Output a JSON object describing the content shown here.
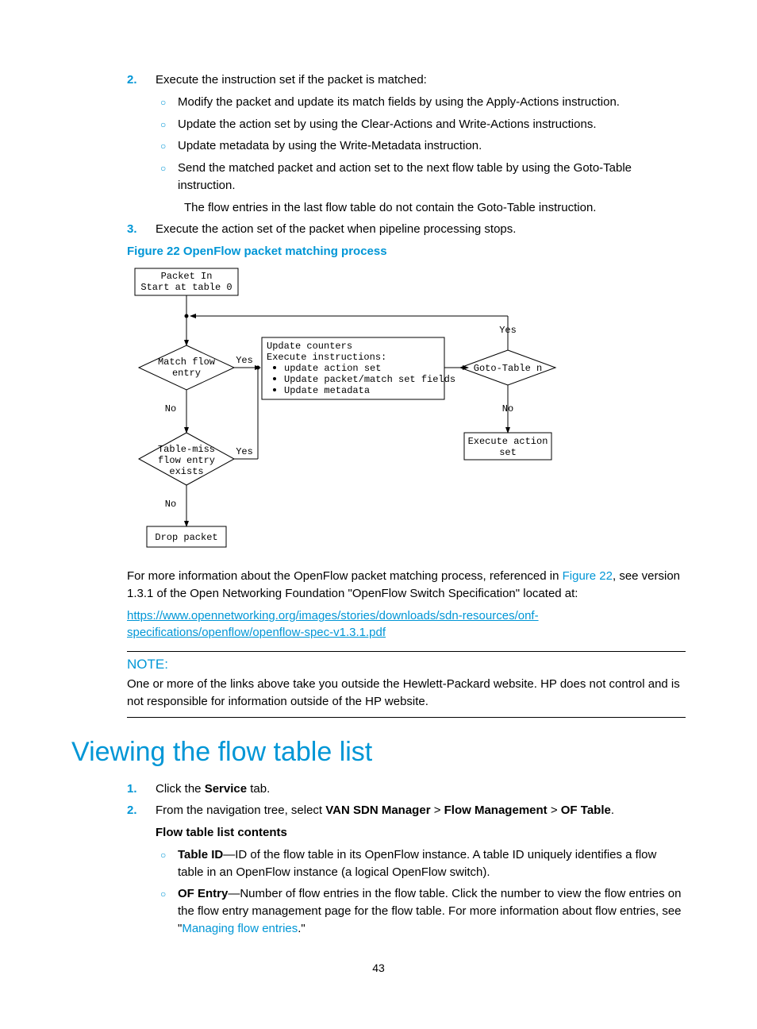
{
  "step2": {
    "num": "2.",
    "text": "Execute the instruction set if the packet is matched:",
    "subs": [
      "Modify the packet and update its match fields by using the Apply-Actions instruction.",
      "Update the action set by using the Clear-Actions and Write-Actions instructions.",
      "Update metadata by using the Write-Metadata instruction.",
      "Send the matched packet and action set to the next flow table by using the Goto-Table instruction."
    ],
    "trail": "The flow entries in the last flow table do not contain the Goto-Table instruction."
  },
  "step3": {
    "num": "3.",
    "text": "Execute the action set of the packet when pipeline processing stops."
  },
  "figure": {
    "caption": "Figure 22 OpenFlow packet matching process",
    "box_packet_in": "Packet In\nStart at table 0",
    "d_match": "Match flow\nentry",
    "yes1": "Yes",
    "no1": "No",
    "d_tablemiss": "Table-miss\nflow entry\nexists",
    "yes2": "Yes",
    "no2": "No",
    "box_drop": "Drop packet",
    "box_update_title": "Update counters",
    "box_update_line2": "Execute instructions:",
    "box_update_b1": "update action set",
    "box_update_b2": "Update packet/match set fields",
    "box_update_b3": "Update metadata",
    "d_goto": "Goto-Table n",
    "yes3": "Yes",
    "no3": "No",
    "box_exec": "Execute action\nset"
  },
  "after_figure": {
    "pre": "For more information about the OpenFlow packet matching process, referenced in ",
    "link1": "Figure 22",
    "post": ", see version 1.3.1 of the Open Networking Foundation \"OpenFlow Switch Specification\" located at:"
  },
  "spec_link": "https://www.opennetworking.org/images/stories/downloads/sdn-resources/onf-specifications/openflow/openflow-spec-v1.3.1.pdf",
  "note": {
    "label": "NOTE:",
    "text": "One or more of the links above take you outside the Hewlett-Packard website. HP does not control and is not responsible for information outside of the HP website."
  },
  "section2": {
    "title": "Viewing the flow table list",
    "steps": [
      {
        "num": "1.",
        "pre": "Click the ",
        "bold": "Service",
        "post": " tab."
      },
      {
        "num": "2.",
        "pre": "From the navigation tree, select ",
        "b1": "VAN SDN Manager",
        "gt1": " > ",
        "b2": "Flow Management",
        "gt2": " > ",
        "b3": "OF Table",
        "post": ".",
        "subhead": "Flow table list contents",
        "subs": [
          {
            "bold": "Table ID",
            "text": "—ID of the flow table in its OpenFlow instance. A table ID uniquely identifies a flow table in an OpenFlow instance (a logical OpenFlow switch)."
          },
          {
            "bold": "OF Entry",
            "text_pre": "—Number of flow entries in the flow table. Click the number to view the flow entries on the flow entry management page for the flow table. For more information about flow entries, see \"",
            "link": "Managing flow entries",
            "text_post": ".\""
          }
        ]
      }
    ]
  },
  "page_num": "43"
}
